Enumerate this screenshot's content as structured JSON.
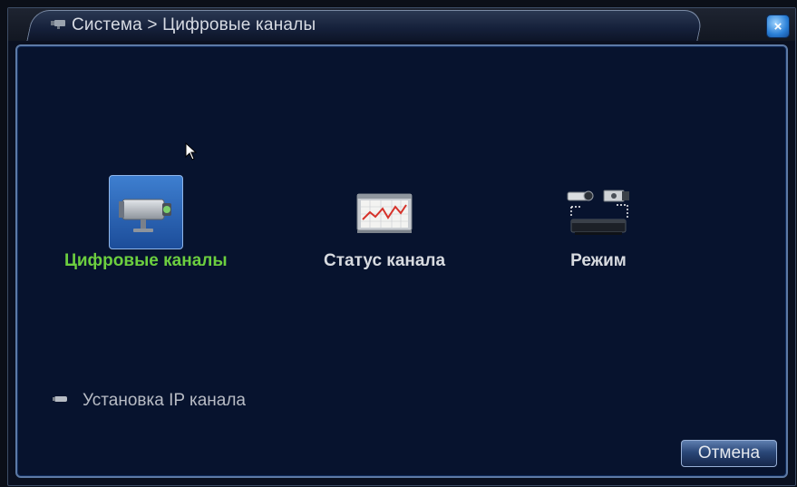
{
  "window": {
    "title": "Система > Цифровые каналы",
    "title_icon": "camera-icon",
    "close_icon": "close-icon",
    "close_label": "×"
  },
  "menu": {
    "items": [
      {
        "label": "Цифровые каналы",
        "icon": "ip-camera-icon",
        "selected": true
      },
      {
        "label": "Статус канала",
        "icon": "chart-monitor-icon",
        "selected": false
      },
      {
        "label": "Режим",
        "icon": "cameras-recorder-icon",
        "selected": false
      }
    ]
  },
  "ip_setup": {
    "label": "Установка IP канала",
    "icon": "camera-small-icon"
  },
  "buttons": {
    "cancel": "Отмена"
  },
  "colors": {
    "active_label": "#6ccf3f",
    "normal_label": "#d8dbe0",
    "background": "#07132e",
    "selection": "#3e7fd0"
  }
}
